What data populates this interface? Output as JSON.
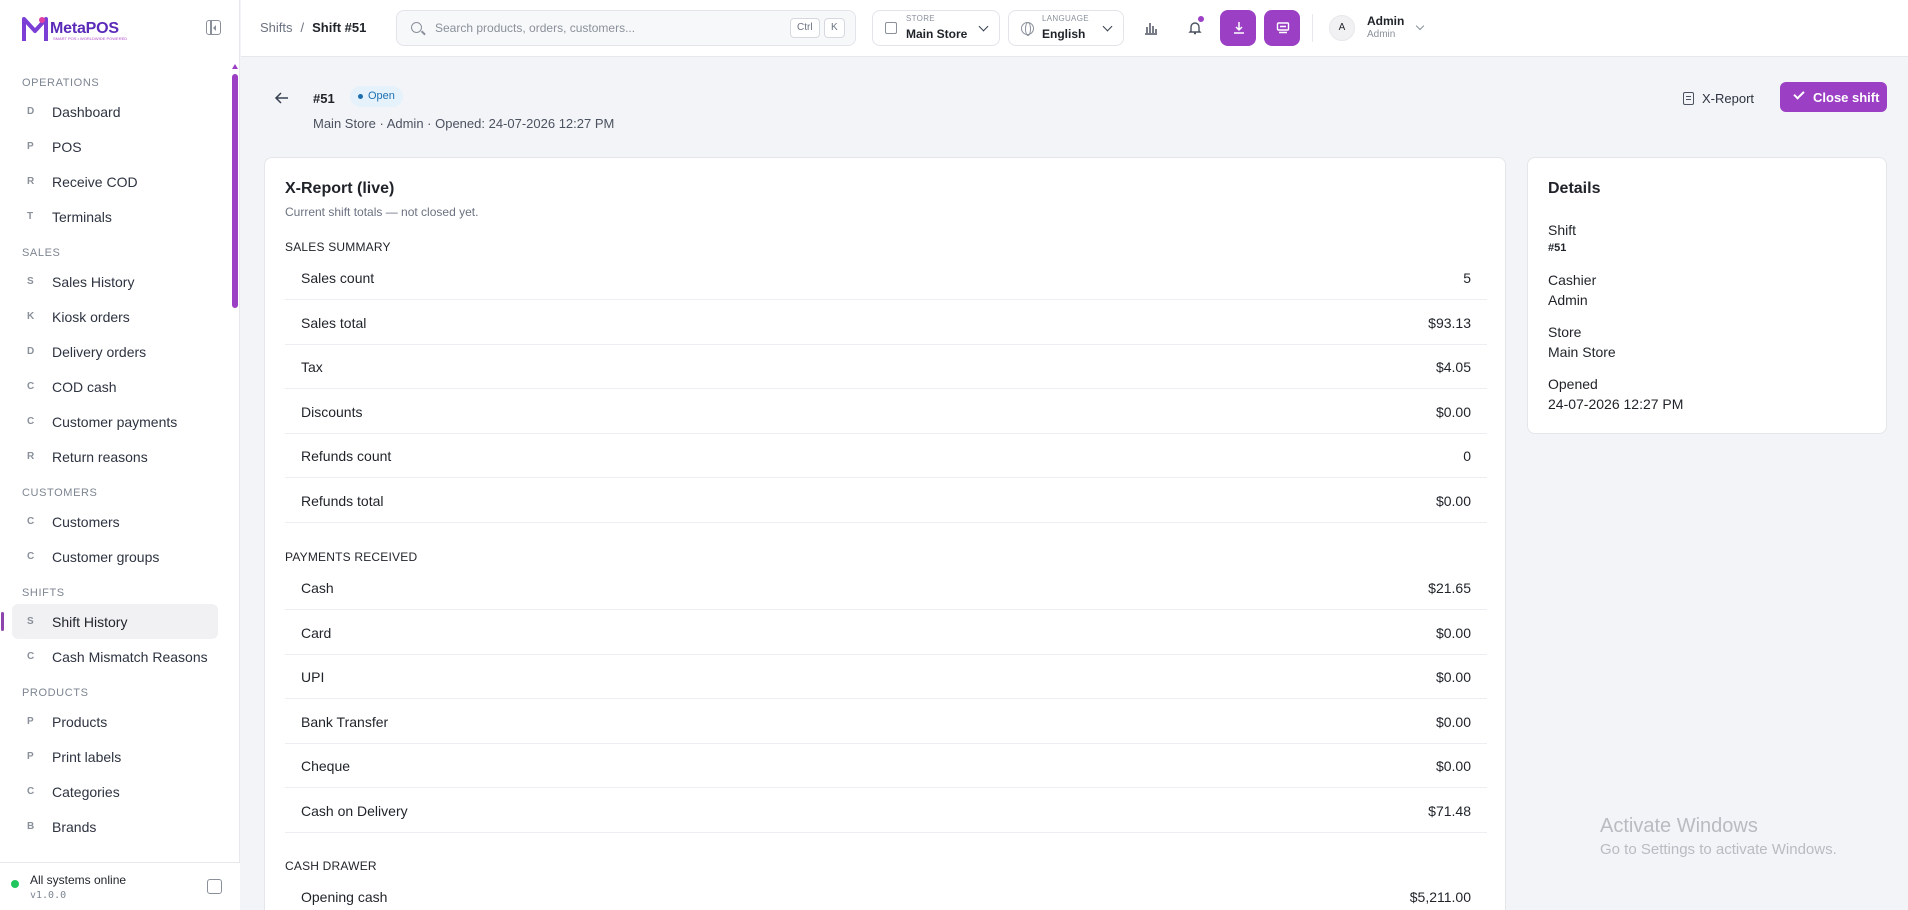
{
  "app": {
    "logo_text": "MetaPOS",
    "logo_tagline": "SMART POS • WORLDWIDE POWERED",
    "brand_color": "#9b3fc4"
  },
  "sidebar": {
    "sections": [
      {
        "title": "OPERATIONS",
        "items": [
          {
            "letter": "D",
            "label": "Dashboard"
          },
          {
            "letter": "P",
            "label": "POS"
          },
          {
            "letter": "R",
            "label": "Receive COD"
          },
          {
            "letter": "T",
            "label": "Terminals"
          }
        ]
      },
      {
        "title": "SALES",
        "items": [
          {
            "letter": "S",
            "label": "Sales History"
          },
          {
            "letter": "K",
            "label": "Kiosk orders"
          },
          {
            "letter": "D",
            "label": "Delivery orders"
          },
          {
            "letter": "C",
            "label": "COD cash"
          },
          {
            "letter": "C",
            "label": "Customer payments"
          },
          {
            "letter": "R",
            "label": "Return reasons"
          }
        ]
      },
      {
        "title": "CUSTOMERS",
        "items": [
          {
            "letter": "C",
            "label": "Customers"
          },
          {
            "letter": "C",
            "label": "Customer groups"
          }
        ]
      },
      {
        "title": "SHIFTS",
        "items": [
          {
            "letter": "S",
            "label": "Shift History",
            "active": true
          },
          {
            "letter": "C",
            "label": "Cash Mismatch Reasons"
          }
        ]
      },
      {
        "title": "PRODUCTS",
        "items": [
          {
            "letter": "P",
            "label": "Products"
          },
          {
            "letter": "P",
            "label": "Print labels"
          },
          {
            "letter": "C",
            "label": "Categories"
          },
          {
            "letter": "B",
            "label": "Brands"
          }
        ]
      }
    ],
    "footer": {
      "status": "All systems online",
      "version": "v1.0.0",
      "status_color": "#22c55e"
    }
  },
  "topbar": {
    "breadcrumb": {
      "parent": "Shifts",
      "separator": "/",
      "current": "Shift #51"
    },
    "search": {
      "placeholder": "Search products, orders, customers...",
      "kbd1": "Ctrl",
      "kbd2": "K"
    },
    "store": {
      "caption": "STORE",
      "value": "Main Store"
    },
    "language": {
      "caption": "LANGUAGE",
      "value": "English"
    },
    "user": {
      "initial": "A",
      "name": "Admin",
      "role": "Admin"
    }
  },
  "page": {
    "shift_id": "#51",
    "status": "Open",
    "subtitle": "Main Store · Admin · Opened: 24-07-2026 12:27 PM",
    "xreport_label": "X-Report",
    "close_label": "Close shift"
  },
  "report": {
    "title": "X-Report (live)",
    "subtitle": "Current shift totals — not closed yet.",
    "sales_summary": {
      "label": "SALES SUMMARY",
      "rows": [
        {
          "k": "Sales count",
          "v": "5"
        },
        {
          "k": "Sales total",
          "v": "$93.13"
        },
        {
          "k": "Tax",
          "v": "$4.05"
        },
        {
          "k": "Discounts",
          "v": "$0.00"
        },
        {
          "k": "Refunds count",
          "v": "0"
        },
        {
          "k": "Refunds total",
          "v": "$0.00"
        }
      ]
    },
    "payments": {
      "label": "PAYMENTS RECEIVED",
      "rows": [
        {
          "k": "Cash",
          "v": "$21.65"
        },
        {
          "k": "Card",
          "v": "$0.00"
        },
        {
          "k": "UPI",
          "v": "$0.00"
        },
        {
          "k": "Bank Transfer",
          "v": "$0.00"
        },
        {
          "k": "Cheque",
          "v": "$0.00"
        },
        {
          "k": "Cash on Delivery",
          "v": "$71.48"
        }
      ]
    },
    "cash_drawer": {
      "label": "CASH DRAWER",
      "rows": [
        {
          "k": "Opening cash",
          "v": "$5,211.00"
        }
      ]
    }
  },
  "details": {
    "title": "Details",
    "shift_label": "Shift",
    "shift_value": "#51",
    "cashier_label": "Cashier",
    "cashier_value": "Admin",
    "store_label": "Store",
    "store_value": "Main Store",
    "opened_label": "Opened",
    "opened_value": "24-07-2026 12:27 PM"
  },
  "watermark": {
    "line1": "Activate Windows",
    "line2": "Go to Settings to activate Windows."
  }
}
